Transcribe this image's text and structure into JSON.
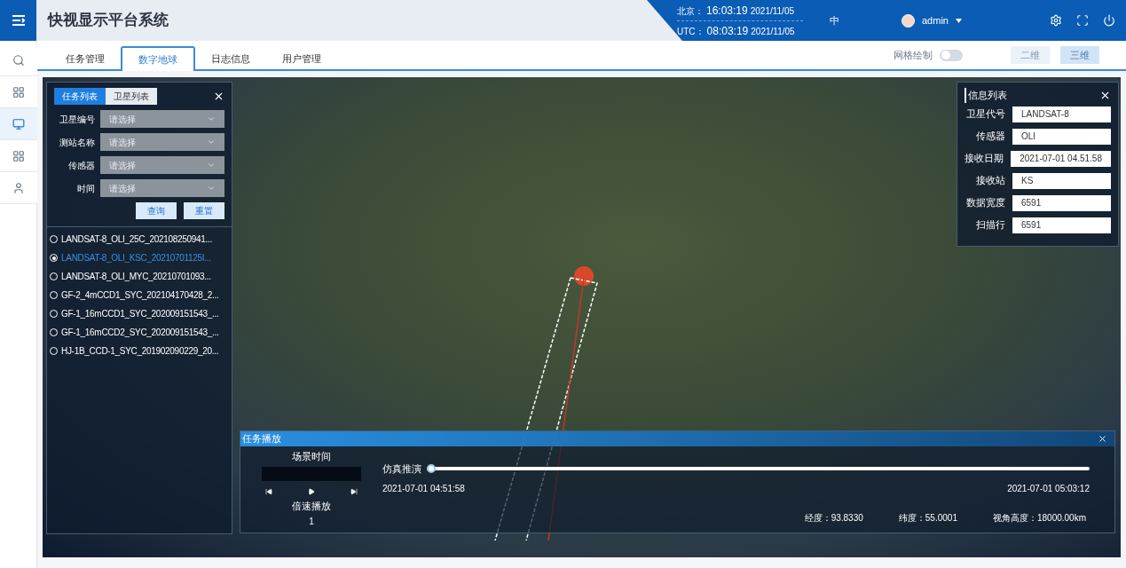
{
  "header": {
    "title": "快视显示平台系统",
    "beijing_label": "北京：",
    "beijing_time": "16:03:19",
    "beijing_date": "2021/11/05",
    "utc_label": "UTC：",
    "utc_time": "08:03:19",
    "utc_date": "2021/11/05",
    "language": "中",
    "user": "admin"
  },
  "sidebar": {
    "items": [
      {
        "kind": "search",
        "selected": false
      },
      {
        "kind": "grid",
        "selected": false
      },
      {
        "kind": "monitor",
        "selected": true
      },
      {
        "kind": "grid",
        "selected": false
      },
      {
        "kind": "user",
        "selected": false
      }
    ]
  },
  "tabs": [
    {
      "label": "任务管理",
      "selected": false
    },
    {
      "label": "数字地球",
      "selected": true
    },
    {
      "label": "日志信息",
      "selected": false
    },
    {
      "label": "用户管理",
      "selected": false
    }
  ],
  "toolbar": {
    "grid_toggle": {
      "label": "网格绘制",
      "on": false
    },
    "view_buttons": [
      {
        "label": "二维",
        "selected": false
      },
      {
        "label": "三维",
        "selected": true
      }
    ]
  },
  "task_panel": {
    "tabs": [
      {
        "label": "任务列表",
        "selected": true
      },
      {
        "label": "卫星列表",
        "selected": false
      }
    ],
    "filters": [
      {
        "label": "卫星编号",
        "placeholder": "请选择"
      },
      {
        "label": "测站名称",
        "placeholder": "请选择"
      },
      {
        "label": "传感器",
        "placeholder": "请选择"
      },
      {
        "label": "时间",
        "placeholder": "请选择"
      }
    ],
    "buttons": [
      "查询",
      "重置"
    ],
    "tasks": [
      {
        "name": "LANDSAT-8_OLI_25C_202108250941...",
        "selected": false
      },
      {
        "name": "LANDSAT-8_OLI_KSC_20210701125I...",
        "selected": true
      },
      {
        "name": "LANDSAT-8_OLI_MYC_20210701093...",
        "selected": false
      },
      {
        "name": "GF-2_4mCCD1_SYC_202104170428_2...",
        "selected": false
      },
      {
        "name": "GF-1_16mCCD1_SYC_202009151543_...",
        "selected": false
      },
      {
        "name": "GF-1_16mCCD2_SYC_202009151543_...",
        "selected": false
      },
      {
        "name": "HJ-1B_CCD-1_SYC_201902090229_20...",
        "selected": false
      }
    ]
  },
  "info_panel": {
    "title": "信息列表",
    "fields": [
      {
        "label": "卫星代号",
        "value": "LANDSAT-8"
      },
      {
        "label": "传感器",
        "value": "OLI"
      },
      {
        "label": "接收日期",
        "value": "2021-07-01 04.51.58"
      },
      {
        "label": "接收站",
        "value": "KS"
      },
      {
        "label": "数据宽度",
        "value": "6591"
      },
      {
        "label": "扫描行",
        "value": "6591"
      }
    ]
  },
  "playback": {
    "title": "任务播放",
    "scene_time_label": "场景时间",
    "speed_label": "倍速播放",
    "speed": "1",
    "sim_label": "仿真推演",
    "level": 0,
    "start_time": "2021-07-01 04:51:58",
    "end_time": "2021-07-01 05:03:12",
    "readouts": [
      {
        "label": "经度：",
        "value": "93.8330"
      },
      {
        "label": "纬度：",
        "value": "55.0001"
      },
      {
        "label": "视角高度：",
        "value": "18000.00km"
      }
    ]
  }
}
